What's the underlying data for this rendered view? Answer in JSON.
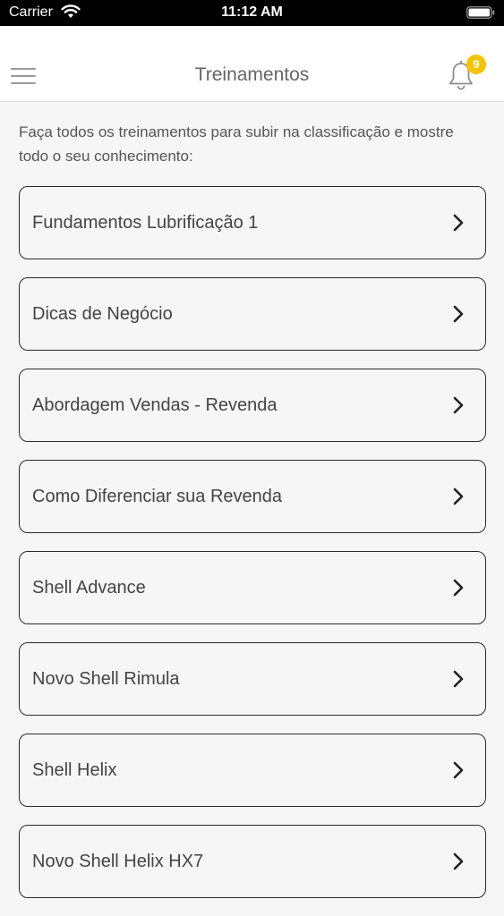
{
  "status_bar": {
    "carrier": "Carrier",
    "time": "11:12 AM"
  },
  "header": {
    "title": "Treinamentos",
    "notifications_count": "9",
    "badge_color": "#f5c400"
  },
  "intro_text": "Faça todos os treinamentos para subir na classificação e mostre todo o seu conhecimento:",
  "trainings": [
    {
      "label": "Fundamentos Lubrificação 1"
    },
    {
      "label": "Dicas de Negócio"
    },
    {
      "label": "Abordagem Vendas - Revenda"
    },
    {
      "label": "Como Diferenciar sua Revenda"
    },
    {
      "label": "Shell Advance"
    },
    {
      "label": "Novo Shell Rimula"
    },
    {
      "label": "Shell Helix"
    },
    {
      "label": "Novo Shell Helix HX7"
    }
  ],
  "icons": {
    "menu": "hamburger-menu-icon",
    "notifications": "bell-icon",
    "item_arrow": "chevron-right-icon"
  }
}
